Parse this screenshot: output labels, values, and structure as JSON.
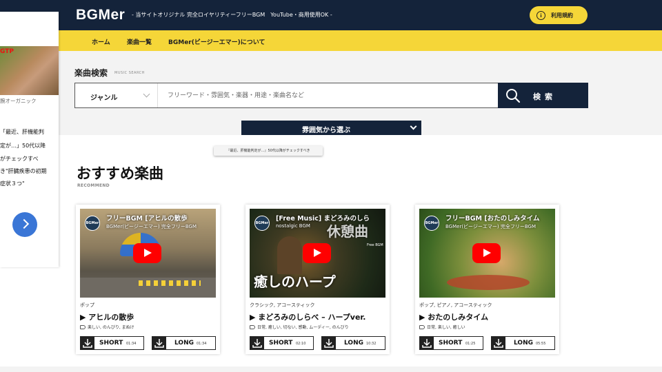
{
  "header": {
    "logo": "BGMer",
    "tagline": "- 当サイトオリジナル 完全ロイヤリティーフリーBGM　YouTube・商用使用OK -",
    "terms_label": "利用規約",
    "terms_icon_glyph": "i"
  },
  "nav": {
    "items": [
      "ホーム",
      "楽曲一覧",
      "BGMer(ビージーエマー)について"
    ]
  },
  "search": {
    "title": "楽曲検索",
    "subtitle": "MUSIC SEARCH",
    "genre_label": "ジャンル",
    "placeholder": "フリーワード・雰囲気・楽器・用途・楽曲名など",
    "button_label": "検索",
    "mood_label": "雰囲気から選ぶ"
  },
  "tooltip": "『最近、肝機能判定が…』50代以降がチェックすべき",
  "recommend": {
    "title": "おすすめ楽曲",
    "subtitle": "RECOMMEND",
    "cards": [
      {
        "video_title": "フリーBGM [アヒルの散歩",
        "video_sub": "BGMer(ビージーエマー) 完全フリーBGM",
        "channel": "BGMer",
        "genre": "ポップ",
        "song": "▶ アヒルの散歩",
        "tags": "楽しい, のんびり, まぬけ",
        "short_label": "SHORT",
        "short_dur": "01:34",
        "long_label": "LONG",
        "long_dur": "01:34"
      },
      {
        "video_title": "[Free Music] まどろみのしら",
        "video_sub": "nostalgic BGM",
        "channel": "BGMer",
        "overlay_big": "癒しのハープ",
        "overlay_rest": "休憩曲",
        "overlay_free": "Free BGM",
        "genre": "クラシック, アコースティック",
        "song": "▶ まどろみのしらべ – ハープver.",
        "tags": "日常, 癒しい, 切ない, 感動, ムーディー, のんびり",
        "short_label": "SHORT",
        "short_dur": "02:10",
        "long_label": "LONG",
        "long_dur": "10:32"
      },
      {
        "video_title": "フリーBGM [おたのしみタイム",
        "video_sub": "BGMer(ビージーエマー) 完全フリーBGM",
        "channel": "BGMer",
        "genre": "ポップ, ピアノ, アコースティック",
        "song": "▶ おたのしみタイム",
        "tags": "日常, 楽しい, 癒しい",
        "short_label": "SHORT",
        "short_dur": "01:25",
        "long_label": "LONG",
        "long_dur": "05:55"
      }
    ]
  },
  "ad": {
    "badge": "GTP",
    "caption": "腕オーガニック",
    "lines": [
      "「最近、肝機能判",
      "定が…」50代以降",
      "がチェックすべ",
      "き\"肝臓疾患の初期",
      "症状３つ\""
    ]
  },
  "colors": {
    "navy": "#14233a",
    "yellow": "#f5d638",
    "play_red": "#ff0000",
    "ad_blue": "#3a76d6"
  }
}
